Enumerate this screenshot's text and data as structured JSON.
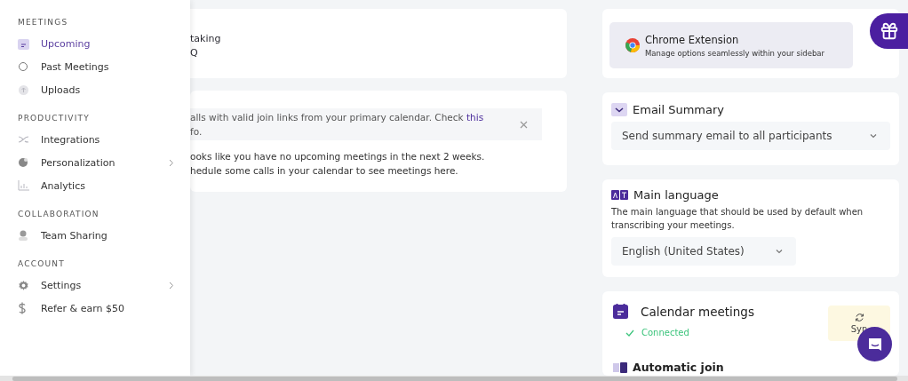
{
  "sidebar": {
    "sections": [
      {
        "heading": "MEETINGS",
        "items": [
          {
            "label": "Upcoming",
            "kind": "calendar",
            "selected": true,
            "submenu": false
          },
          {
            "label": "Past Meetings",
            "kind": "circle",
            "selected": false,
            "submenu": false
          },
          {
            "label": "Uploads",
            "kind": "upload",
            "selected": false,
            "submenu": false
          }
        ]
      },
      {
        "heading": "PRODUCTIVITY",
        "items": [
          {
            "label": "Integrations",
            "kind": "shuffle",
            "selected": false,
            "submenu": false
          },
          {
            "label": "Personalization",
            "kind": "palette",
            "selected": false,
            "submenu": true
          },
          {
            "label": "Analytics",
            "kind": "chart",
            "selected": false,
            "submenu": false
          }
        ]
      },
      {
        "heading": "COLLABORATION",
        "items": [
          {
            "label": "Team Sharing",
            "kind": "person",
            "selected": false,
            "submenu": false
          }
        ]
      },
      {
        "heading": "ACCOUNT",
        "items": [
          {
            "label": "Settings",
            "kind": "gear",
            "selected": false,
            "submenu": true
          },
          {
            "label": "Refer & earn $50",
            "kind": "dollar",
            "selected": false,
            "submenu": false
          }
        ]
      }
    ]
  },
  "banner": {
    "lines": [
      "taking",
      "Q"
    ]
  },
  "upcoming": {
    "notice": {
      "text": "alls with valid join links from your primary calendar. Check ",
      "link": "this",
      "text2": "fo."
    },
    "empty_lines": [
      "ooks like you have no upcoming meetings in the next 2 weeks.",
      "hedule some calls in your calendar to see meetings here."
    ]
  },
  "chrome_extension": {
    "title": "Chrome Extension",
    "subtitle": "Manage options seamlessly within your sidebar"
  },
  "email_summary": {
    "title": "Email Summary",
    "value": "Send summary email to all participants"
  },
  "main_language": {
    "title": "Main language",
    "description": "The main language that should be used by default when transcribing your meetings.",
    "value": "English (United States)"
  },
  "calendar": {
    "title": "Calendar meetings",
    "status": "Connected",
    "sync_label": "Syn"
  },
  "automatic_join": {
    "title": "Automatic join"
  }
}
